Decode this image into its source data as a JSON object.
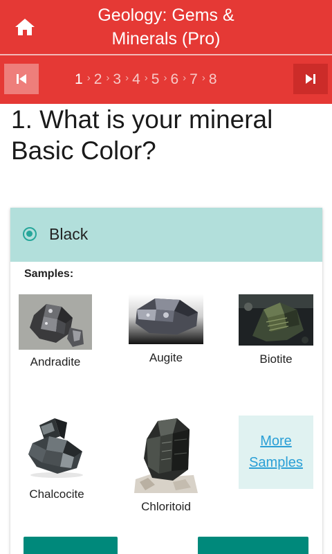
{
  "app": {
    "title": "Geology: Gems &\nMinerals (Pro)",
    "accent": "#e53935",
    "selection_color": "#b2dfdb",
    "button_color": "#00897b"
  },
  "header": {
    "home_icon": "home-icon"
  },
  "stepper": {
    "first_icon": "skip-previous-icon",
    "last_icon": "skip-next-icon",
    "current": "1",
    "steps": [
      "1",
      "2",
      "3",
      "4",
      "5",
      "6",
      "7",
      "8"
    ]
  },
  "question": {
    "text": "1. What is your mineral Basic Color?"
  },
  "option": {
    "label": "Black",
    "selected": true
  },
  "samples": {
    "label": "Samples:",
    "items": [
      {
        "name": "Andradite"
      },
      {
        "name": "Augite"
      },
      {
        "name": "Biotite"
      },
      {
        "name": "Chalcocite"
      },
      {
        "name": "Chloritoid"
      }
    ],
    "more_label": "More Samples"
  }
}
